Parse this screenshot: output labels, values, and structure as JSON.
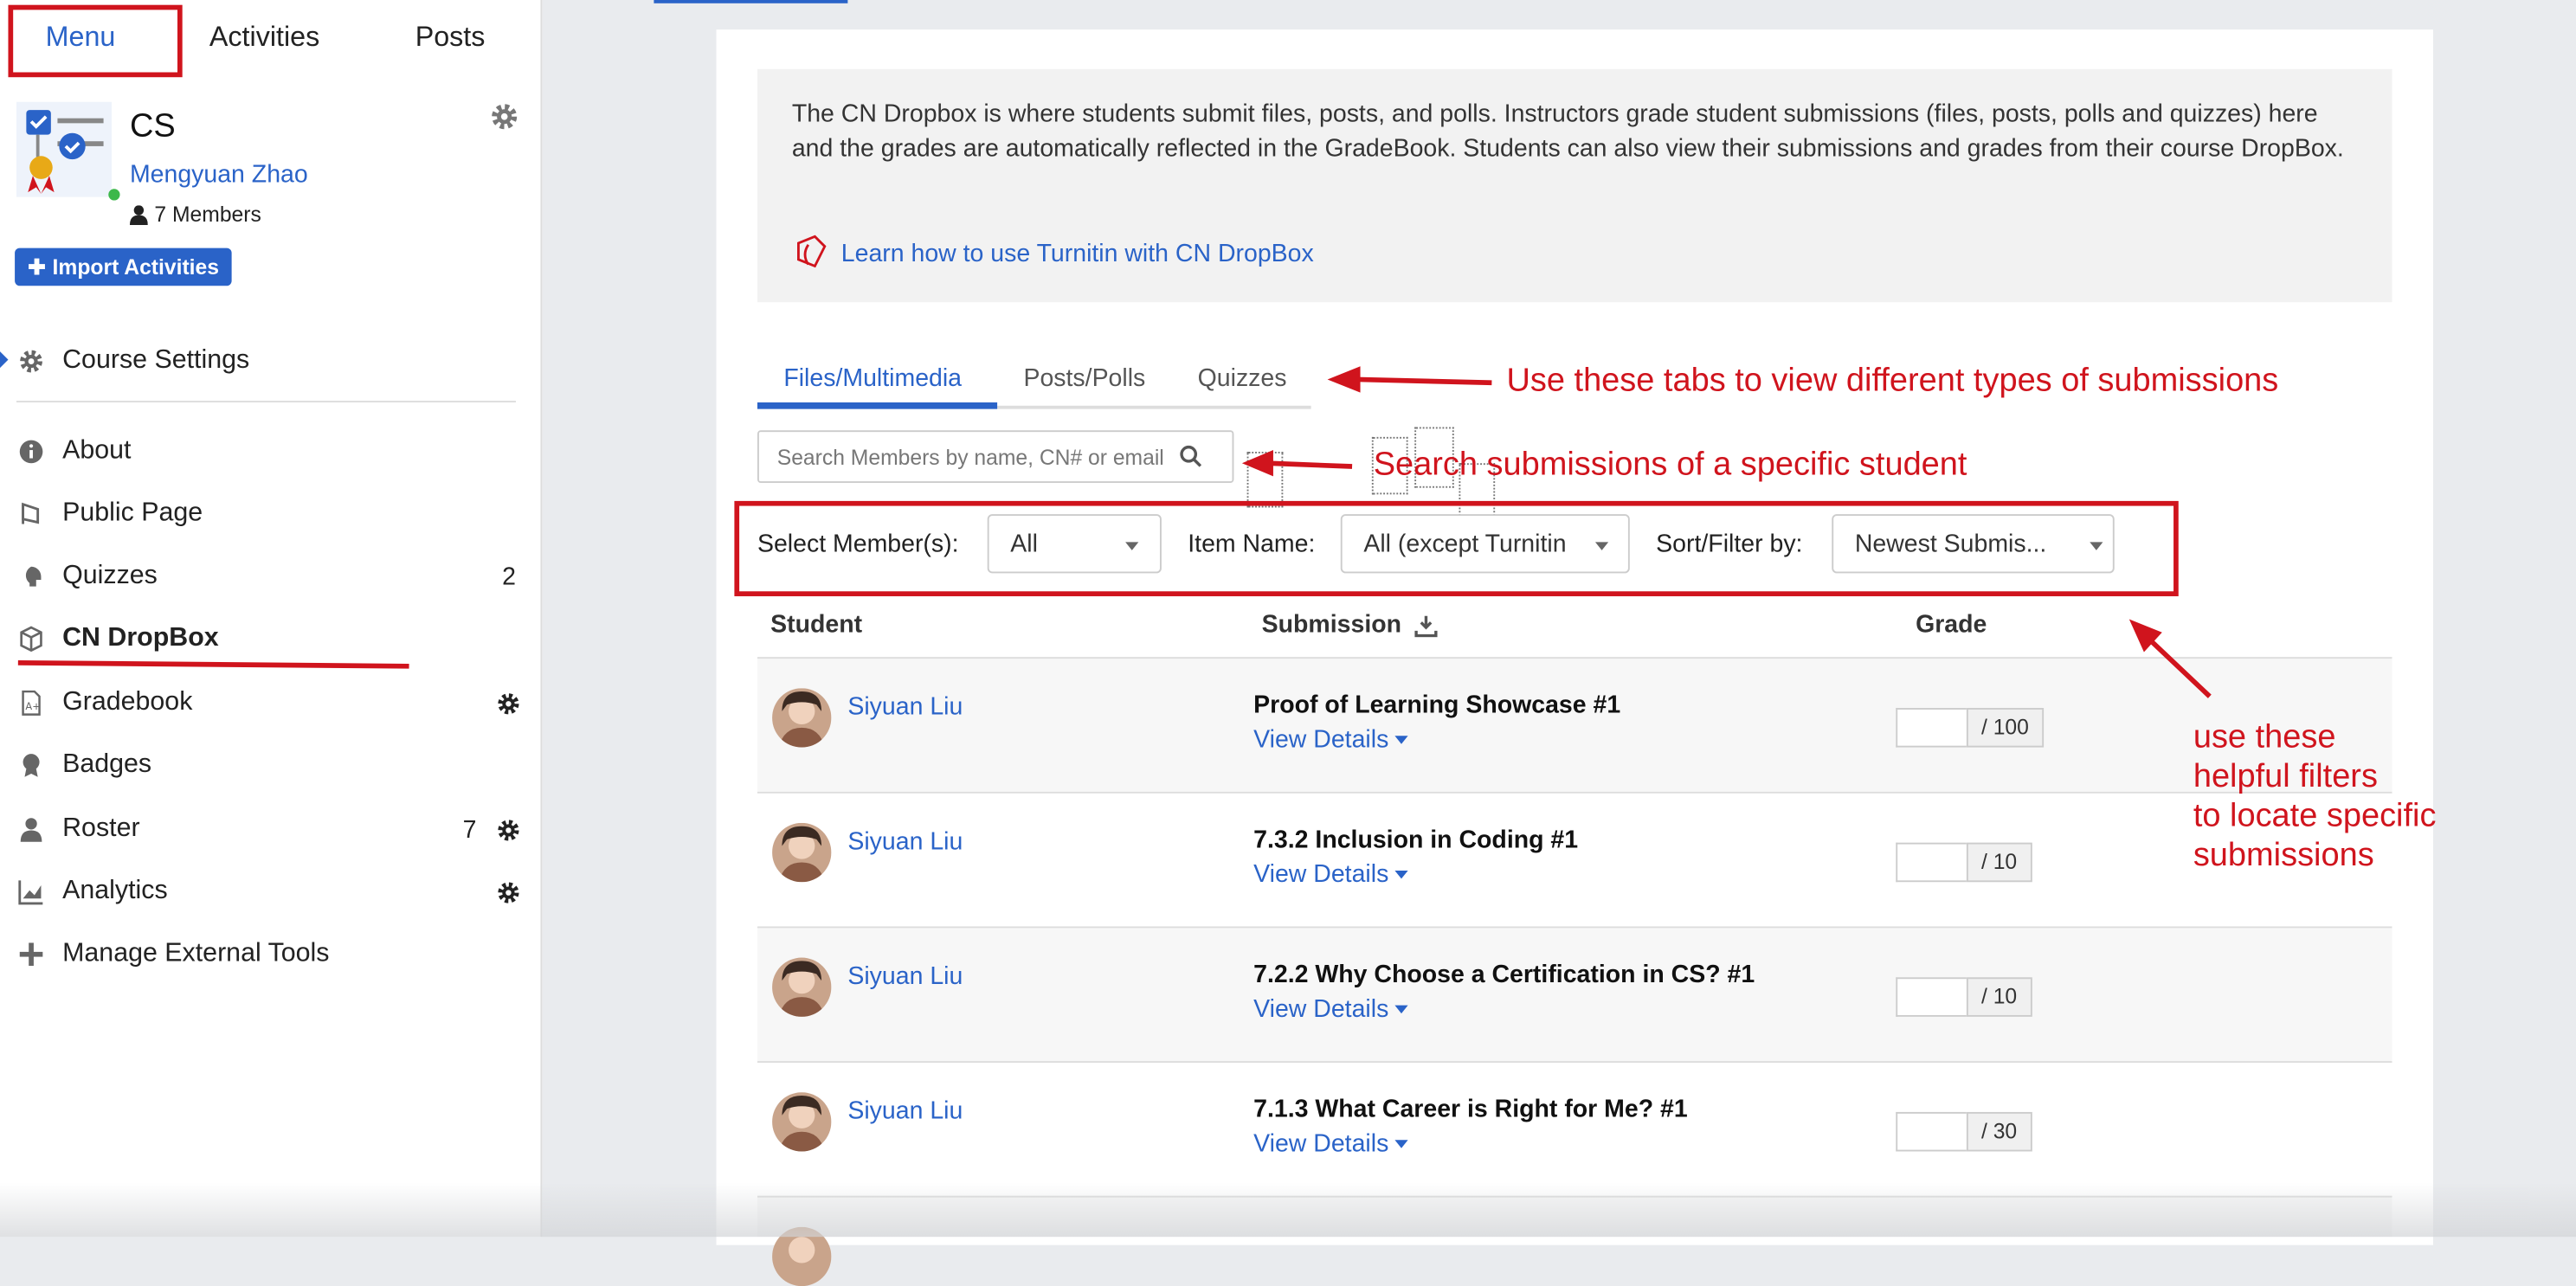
{
  "top_tabs": [
    "Menu",
    "Activities",
    "Posts"
  ],
  "course": {
    "title": "CS",
    "owner": "Mengyuan Zhao",
    "members": "7 Members",
    "import_label": "Import Activities"
  },
  "sidebar": {
    "course_settings": "Course Settings",
    "items": [
      {
        "label": "About",
        "icon": "info-icon",
        "count": "",
        "gear": false,
        "bold": false
      },
      {
        "label": "Public Page",
        "icon": "public-page-icon",
        "count": "",
        "gear": false,
        "bold": false
      },
      {
        "label": "Quizzes",
        "icon": "quizzes-icon",
        "count": "2",
        "gear": false,
        "bold": false
      },
      {
        "label": "CN DropBox",
        "icon": "dropbox-icon",
        "count": "",
        "gear": false,
        "bold": true
      },
      {
        "label": "Gradebook",
        "icon": "gradebook-icon",
        "count": "",
        "gear": true,
        "bold": false
      },
      {
        "label": "Badges",
        "icon": "badge-icon",
        "count": "",
        "gear": false,
        "bold": false
      },
      {
        "label": "Roster",
        "icon": "roster-icon",
        "count": "7",
        "gear": true,
        "bold": false
      },
      {
        "label": "Analytics",
        "icon": "analytics-icon",
        "count": "",
        "gear": true,
        "bold": false
      },
      {
        "label": "Manage External Tools",
        "icon": "plus-icon",
        "count": "",
        "gear": false,
        "bold": false
      }
    ]
  },
  "info": {
    "text": "The CN Dropbox is where students submit files, posts, and polls. Instructors grade student submissions (files, posts, polls and quizzes) here and the grades are automatically reflected in the GradeBook. Students can also view their submissions and grades from their course DropBox.",
    "link": "Learn how to use Turnitin with CN DropBox"
  },
  "sub_tabs": [
    "Files/Multimedia",
    "Posts/Polls",
    "Quizzes"
  ],
  "search": {
    "placeholder": "Search Members by name, CN# or email"
  },
  "filters": {
    "member_label": "Select Member(s):",
    "member_value": "All",
    "item_label": "Item Name:",
    "item_value": "All (except Turnitin",
    "sort_label": "Sort/Filter by:",
    "sort_value": "Newest Submis..."
  },
  "table": {
    "headers": {
      "student": "Student",
      "submission": "Submission",
      "grade": "Grade"
    },
    "rows": [
      {
        "student": "Siyuan Liu",
        "item": "Proof of Learning Showcase #1",
        "details": "View Details",
        "max": "/ 100"
      },
      {
        "student": "Siyuan Liu",
        "item": "7.3.2 Inclusion in Coding #1",
        "details": "View Details",
        "max": "/ 10"
      },
      {
        "student": "Siyuan Liu",
        "item": "7.2.2 Why Choose a Certification in CS? #1",
        "details": "View Details",
        "max": "/ 10"
      },
      {
        "student": "Siyuan Liu",
        "item": "7.1.3 What Career is Right for Me? #1",
        "details": "View Details",
        "max": "/ 30"
      }
    ]
  },
  "annotations": {
    "tabs_note": "Use these tabs to view different types of submissions",
    "search_note": "Search submissions of a specific student",
    "filters_note": [
      "use these",
      "helpful filters",
      "to locate specific",
      "submissions"
    ]
  },
  "colors": {
    "accent": "#2a63c8",
    "annotation": "#d0141d"
  }
}
